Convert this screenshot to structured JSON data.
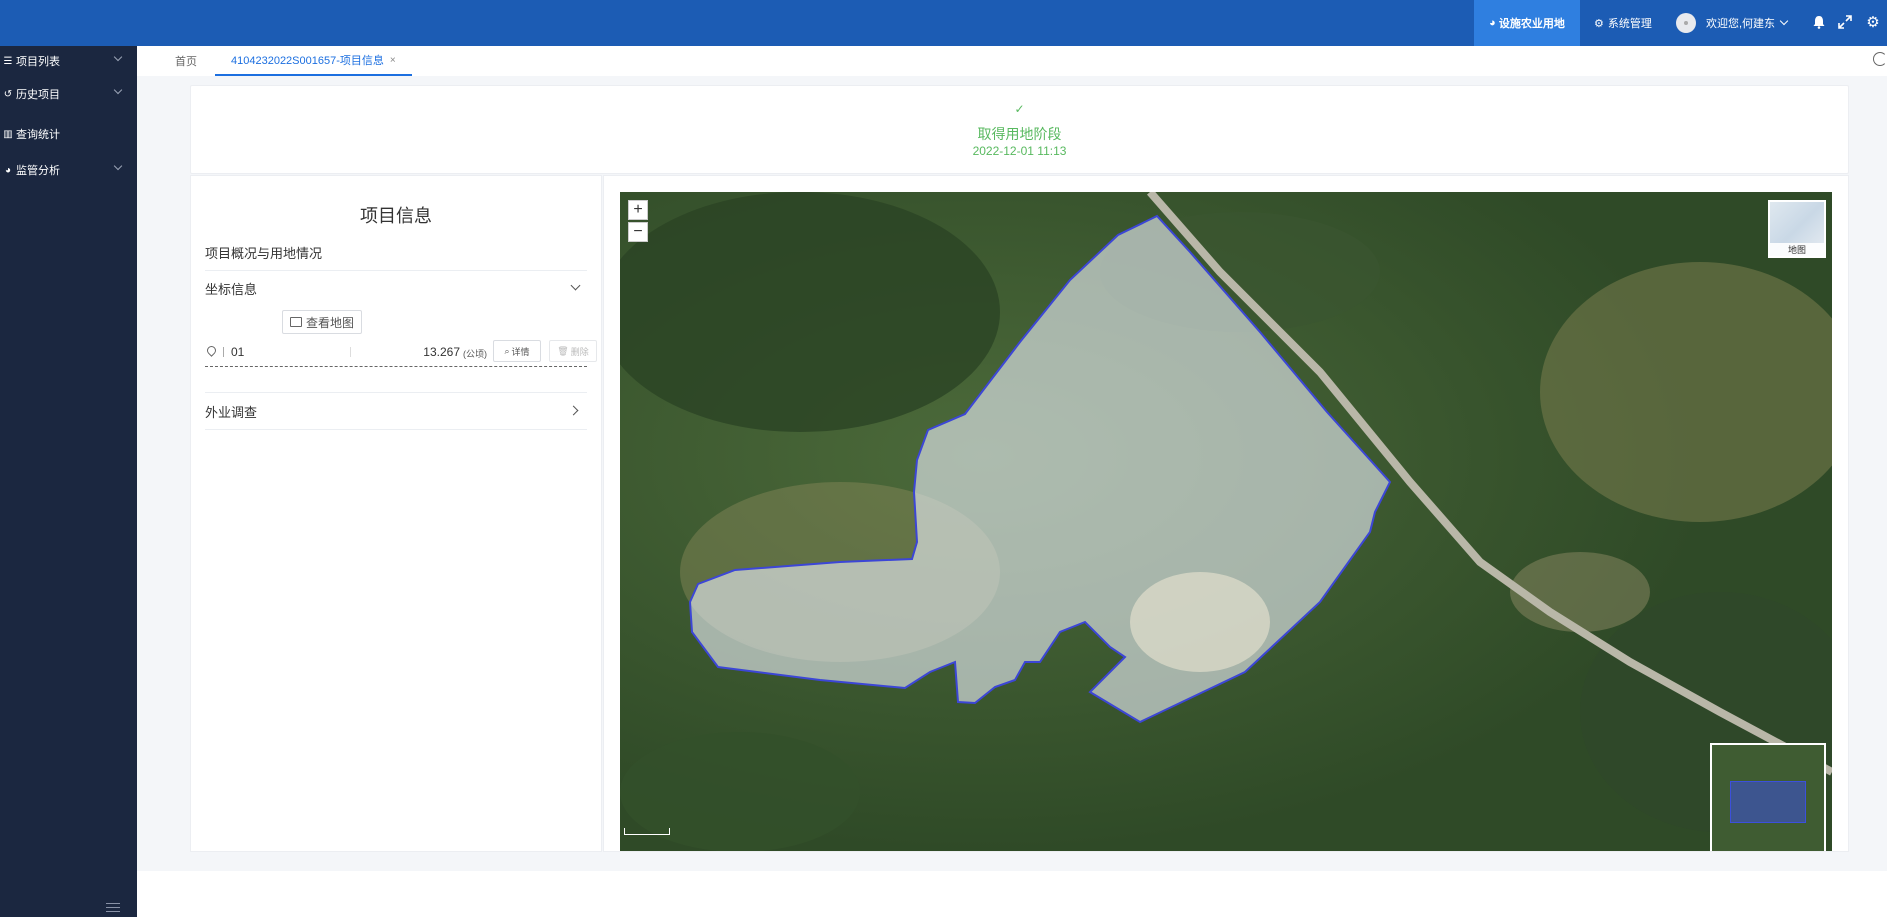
{
  "header": {
    "nav_active": "设施农业用地",
    "nav_system": "系统管理",
    "welcome": "欢迎您,何建东"
  },
  "sidebar": {
    "items": [
      {
        "label": "项目列表",
        "icon": "list-icon"
      },
      {
        "label": "历史项目",
        "icon": "history-icon"
      },
      {
        "label": "查询统计",
        "icon": "chart-icon"
      },
      {
        "label": "监管分析",
        "icon": "pie-icon"
      }
    ]
  },
  "tabs": [
    {
      "label": "首页"
    },
    {
      "label": "4104232022S001657-项目信息",
      "close": "×"
    }
  ],
  "stage": {
    "title": "取得用地阶段",
    "time": "2022-12-01 11:13"
  },
  "info": {
    "title": "项目信息",
    "section_overview": "项目概况与用地情况",
    "section_coord": "坐标信息",
    "view_map": "查看地图",
    "coord_row": {
      "num": "01",
      "area": "13.267",
      "unit": "(公顷)",
      "detail": "详情",
      "delete": "删除"
    },
    "section_field": "外业调查"
  },
  "map": {
    "zoom_in": "+",
    "zoom_out": "−",
    "basemap": "地图",
    "overlay_color": "#3c46d6",
    "overlay_fill": "#e8eef6"
  }
}
